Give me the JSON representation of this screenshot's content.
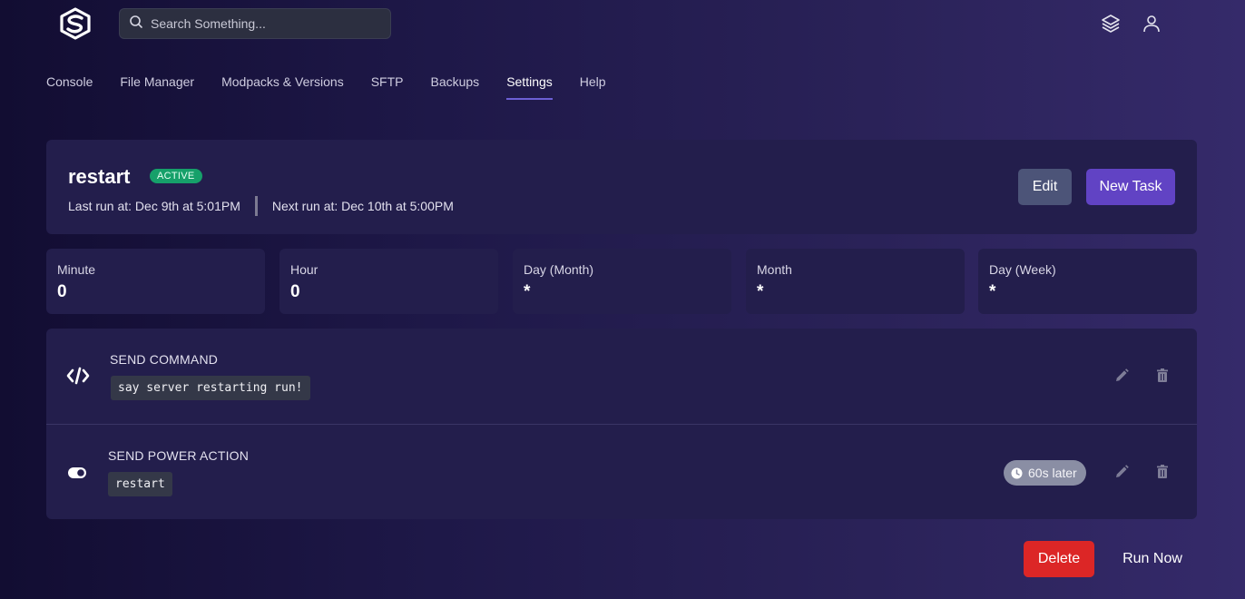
{
  "search": {
    "placeholder": "Search Something..."
  },
  "nav": {
    "tabs": [
      {
        "label": "Console"
      },
      {
        "label": "File Manager"
      },
      {
        "label": "Modpacks & Versions"
      },
      {
        "label": "SFTP"
      },
      {
        "label": "Backups"
      },
      {
        "label": "Settings",
        "active": true
      },
      {
        "label": "Help"
      }
    ]
  },
  "task": {
    "name": "restart",
    "status": "ACTIVE",
    "last_run": "Last run at: Dec 9th at 5:01PM",
    "next_run": "Next run at: Dec 10th at 5:00PM",
    "edit_label": "Edit",
    "new_task_label": "New Task"
  },
  "cron": [
    {
      "label": "Minute",
      "value": "0"
    },
    {
      "label": "Hour",
      "value": "0"
    },
    {
      "label": "Day (Month)",
      "value": "*"
    },
    {
      "label": "Month",
      "value": "*"
    },
    {
      "label": "Day (Week)",
      "value": "*"
    }
  ],
  "actions": [
    {
      "type": "SEND COMMAND",
      "payload": "say server restarting run!",
      "icon": "code-icon"
    },
    {
      "type": "SEND POWER ACTION",
      "payload": "restart",
      "icon": "toggle-icon",
      "delay": "60s later"
    }
  ],
  "footer": {
    "delete_label": "Delete",
    "run_now_label": "Run Now"
  },
  "colors": {
    "accent": "#6143c4",
    "active_badge": "#16a06a",
    "danger": "#dc2626",
    "card": "#231e4c"
  }
}
